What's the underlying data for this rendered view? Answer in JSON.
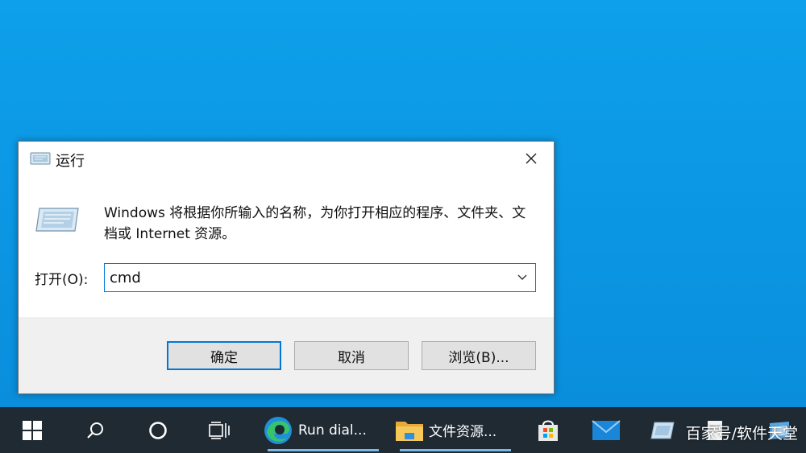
{
  "dialog": {
    "title": "运行",
    "description": "Windows 将根据你所输入的名称，为你打开相应的程序、文件夹、文档或 Internet 资源。",
    "open_label": "打开(O):",
    "input_value": "cmd",
    "buttons": {
      "ok": "确定",
      "cancel": "取消",
      "browse": "浏览(B)..."
    }
  },
  "taskbar": {
    "apps": [
      {
        "label": "Run dial...",
        "icon": "edge-icon"
      },
      {
        "label": "文件资源...",
        "icon": "folder-icon"
      }
    ]
  },
  "watermark": "百家号/软件天堂",
  "colors": {
    "desktop": "#0f9ee8",
    "taskbar": "#1f2a33",
    "accent": "#0078d7"
  }
}
